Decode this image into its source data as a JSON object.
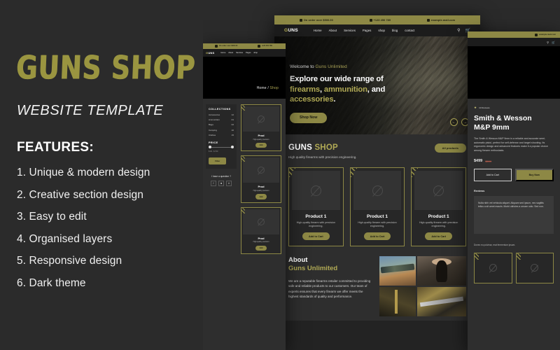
{
  "promo": {
    "logo": "GUNS SHOP",
    "subtitle": "WEBSITE TEMPLATE",
    "features_title": "FEATURES:",
    "features": [
      "1. Unique & modern design",
      "2. Creative section design",
      "3. Easy to edit",
      "4. Organised layers",
      "5. Responsive design",
      "6. Dark theme"
    ]
  },
  "colors": {
    "accent": "#8d8845",
    "accent_text": "#b1aa55",
    "background": "#2b2b2b",
    "panel": "#2e2e2e",
    "card": "#272727"
  },
  "topbar": {
    "offer": "On order over $500.00",
    "phone": "+123 456 789",
    "email": "example.mail.com"
  },
  "nav": {
    "brand_g": "G",
    "brand_rest": "UNS",
    "links": [
      "Home",
      "About",
      "Services",
      "Pages",
      "shop",
      "blog",
      "contact"
    ],
    "search_icon": "search-icon",
    "cart_icon": "cart-icon"
  },
  "hero": {
    "welcome_prefix": "Welcome to ",
    "welcome_brand": "Guns Unlimited",
    "headline_line1_a": "Explore our wide range of",
    "headline_line2_a": "firearms",
    "headline_line2_b": ", ",
    "headline_line2_c": "ammunition",
    "headline_line2_d": ", and",
    "headline_line3_a": "accessories",
    "headline_line3_b": ".",
    "cta": "Shop Now",
    "prev_icon": "arrow-left-icon",
    "next_icon": "arrow-right-icon"
  },
  "shop_section": {
    "title_a": "GUNS",
    "title_b": "SHOP",
    "subtitle": "High quality firearms with precision engineering.",
    "all_products": "All products",
    "products": [
      {
        "name": "Product 1",
        "desc": "High-quality firearm with precision engineering.",
        "cta": "Add to Cart"
      },
      {
        "name": "Product 1",
        "desc": "High-quality firearm with precision engineering.",
        "cta": "Add to Cart"
      },
      {
        "name": "Product 1",
        "desc": "High-quality firearm with precision engineering.",
        "cta": "Add to Cart"
      }
    ]
  },
  "about": {
    "title_line1": "About",
    "title_line2": "Guns Unlimited",
    "body": "We are a reputable firearms retailer committed to providing safe and reliable products to our customers. Our team of experts ensures that every firearm we offer meets the highest standards of quality and performance."
  },
  "shop_page": {
    "breadcrumb_home": "Home / ",
    "breadcrumb_current": "Shop",
    "collections_title": "COLLECTIONS",
    "collections": [
      {
        "label": "Accessories",
        "count": "12"
      },
      {
        "label": "Ammunition",
        "count": "01"
      },
      {
        "label": "Bags",
        "count": "02"
      },
      {
        "label": "Camping",
        "count": "10"
      },
      {
        "label": "Clothes",
        "count": "15"
      }
    ],
    "price_title": "PRICE",
    "price_range": "$ 00 - $ 700",
    "filter_button": "Filter",
    "question": "I have a question ?",
    "social_icons": [
      "facebook-icon",
      "instagram-icon",
      "twitter-icon"
    ],
    "products": [
      {
        "name": "Prod",
        "desc": "High-quality precision",
        "cta": "Add"
      },
      {
        "name": "Prod",
        "desc": "High-quality precision",
        "cta": "Add"
      },
      {
        "name": "Prod",
        "desc": "High-quality precision",
        "cta": "Add"
      }
    ]
  },
  "product_page": {
    "reviews": "10 Reviews",
    "star_icon": "star-icon",
    "title_line1": "Smith & Wesson",
    "title_line2": "M&P 9mm",
    "description": "The Smith & Wesson M&P 9mm is a reliable and accurate semi-automatic pistol, perfect for self-defense and target shooting. Its ergonomic design and advanced features make it a popular choice among firearm enthusiasts.",
    "price_new": "$499",
    "price_old": "$599",
    "add_to_cart": "Add to Cart",
    "buy_now": "Buy Now",
    "reviews_heading": "Reviews",
    "review_text": "Nulla nibh vel vehicula aliquet. Aliquam sed ipsum, nec sagittis tellus a sit amet mauris. Morbi ultricies a ornare odio. Sed non.",
    "footer_text": "Donec eu pulvinar, erat fermentum ipsum."
  }
}
